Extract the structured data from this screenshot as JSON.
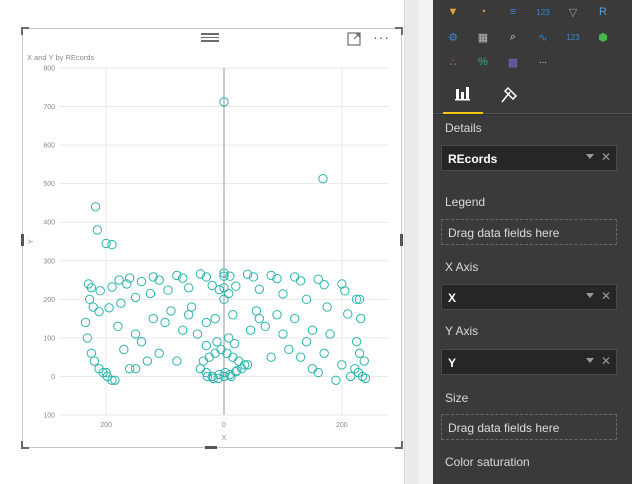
{
  "visual": {
    "title": "X and Y by REcords",
    "more_label": "···"
  },
  "chart_data": {
    "type": "scatter",
    "title": "X and Y by REcords",
    "xlabel": "X",
    "ylabel": "Y",
    "xlim": [
      -280,
      280
    ],
    "ylim": [
      -100,
      800
    ],
    "x_ticks": [
      {
        "value": -200,
        "label": "200"
      },
      {
        "value": 0,
        "label": "0"
      },
      {
        "value": 200,
        "label": "200"
      }
    ],
    "y_ticks": [
      {
        "value": 800,
        "label": "800"
      },
      {
        "value": 700,
        "label": "700"
      },
      {
        "value": 600,
        "label": "600"
      },
      {
        "value": 500,
        "label": "500"
      },
      {
        "value": 400,
        "label": "400"
      },
      {
        "value": 300,
        "label": "300"
      },
      {
        "value": 200,
        "label": "200"
      },
      {
        "value": 100,
        "label": "100"
      },
      {
        "value": 0,
        "label": "0"
      },
      {
        "value": -100,
        "label": "100"
      }
    ],
    "grid": true,
    "marker": "hollow-circle",
    "color": "#2bb5ad",
    "series": [
      {
        "x": [
          0,
          168,
          -218,
          -215,
          -200,
          -190,
          -178,
          -160,
          -120,
          -80,
          -40,
          0,
          40,
          80,
          120,
          160,
          200,
          230,
          -230,
          -225,
          -210,
          -190,
          -165,
          -140,
          -110,
          -70,
          -30,
          10,
          50,
          90,
          130,
          170,
          205,
          225,
          -228,
          -222,
          -212,
          -195,
          -175,
          -150,
          -125,
          -95,
          -60,
          -20,
          20,
          60,
          100,
          140,
          175,
          210,
          232,
          -235,
          -232,
          -225,
          -220,
          -212,
          -205,
          -198,
          -190,
          222,
          228,
          235,
          240,
          238,
          230,
          225,
          -40,
          -30,
          -20,
          -10,
          0,
          10,
          20,
          30,
          40,
          -35,
          -25,
          -15,
          -5,
          5,
          15,
          25,
          35,
          -28,
          -18,
          -8,
          2,
          12,
          22,
          -30,
          -12,
          8,
          18,
          -180,
          -150,
          -120,
          -90,
          -60,
          -30,
          60,
          90,
          120,
          150,
          180,
          -170,
          -140,
          -110,
          -80,
          80,
          110,
          140,
          170,
          -100,
          -70,
          70,
          100,
          -160,
          -55,
          55,
          160,
          -45,
          45,
          -15,
          15,
          0,
          0,
          0,
          8,
          -8,
          200,
          215,
          190,
          -200,
          -185,
          130,
          150,
          -130,
          -150
        ],
        "y": [
          712,
          513,
          440,
          380,
          345,
          342,
          250,
          255,
          258,
          262,
          266,
          268,
          265,
          262,
          258,
          252,
          240,
          200,
          240,
          230,
          222,
          232,
          240,
          246,
          250,
          255,
          258,
          260,
          258,
          254,
          248,
          238,
          222,
          200,
          200,
          180,
          168,
          178,
          190,
          205,
          215,
          224,
          230,
          236,
          234,
          226,
          214,
          200,
          180,
          162,
          150,
          140,
          100,
          60,
          40,
          20,
          10,
          0,
          -10,
          20,
          10,
          0,
          -5,
          40,
          60,
          90,
          20,
          10,
          0,
          -5,
          0,
          5,
          12,
          20,
          30,
          40,
          50,
          60,
          70,
          60,
          50,
          40,
          30,
          0,
          -5,
          5,
          10,
          0,
          15,
          80,
          90,
          100,
          85,
          130,
          110,
          150,
          170,
          160,
          140,
          150,
          160,
          150,
          120,
          110,
          70,
          90,
          60,
          40,
          50,
          70,
          90,
          60,
          140,
          120,
          130,
          110,
          20,
          180,
          170,
          10,
          110,
          120,
          150,
          160,
          200,
          230,
          260,
          215,
          225,
          30,
          0,
          -10,
          10,
          -10,
          50,
          20,
          40,
          20
        ]
      }
    ]
  },
  "viz_pane": {
    "icons": [
      {
        "name": "funnel-icon",
        "glyph": "▼",
        "color": "#e8a33b"
      },
      {
        "name": "gauge-icon",
        "glyph": "◔",
        "color": "#e8a33b"
      },
      {
        "name": "card-icon",
        "glyph": "≡",
        "color": "#3a86d1"
      },
      {
        "name": "multirow-card-icon",
        "glyph": "123",
        "color": "#3a86d1"
      },
      {
        "name": "filter-icon",
        "glyph": "▽",
        "color": "#9a9a9a"
      },
      {
        "name": "r-visual-icon",
        "glyph": "R",
        "color": "#5fa0d8"
      },
      {
        "name": "arcgis-icon",
        "glyph": "⚙",
        "color": "#3a86d1"
      },
      {
        "name": "slicer-icon",
        "glyph": "▦",
        "color": "#bbbbbb"
      },
      {
        "name": "magnifier-icon",
        "glyph": "⌕",
        "color": "#dddddd"
      },
      {
        "name": "line-chart-icon",
        "glyph": "∿",
        "color": "#3a86d1"
      },
      {
        "name": "kpi-icon",
        "glyph": "123",
        "color": "#3a86d1"
      },
      {
        "name": "hexagon-icon",
        "glyph": "⬢",
        "color": "#46b94a"
      },
      {
        "name": "scatter-icon",
        "glyph": "∴",
        "color": "#e05c5c"
      },
      {
        "name": "percent-icon",
        "glyph": "%",
        "color": "#36b37e"
      },
      {
        "name": "matrix-icon",
        "glyph": "▩",
        "color": "#7b63c9"
      },
      {
        "name": "more-visuals-icon",
        "glyph": "···",
        "color": "#ffffff"
      }
    ]
  },
  "pane": {
    "tabs": [
      {
        "name": "fields-tab",
        "icon": "fields-icon"
      },
      {
        "name": "format-tab",
        "icon": "paint-roller-icon"
      }
    ],
    "wells": {
      "details": {
        "label": "Details",
        "value": "REcords"
      },
      "legend": {
        "label": "Legend",
        "placeholder": "Drag data fields here"
      },
      "x_axis": {
        "label": "X Axis",
        "value": "X"
      },
      "y_axis": {
        "label": "Y Axis",
        "value": "Y"
      },
      "size": {
        "label": "Size",
        "placeholder": "Drag data fields here"
      },
      "color_saturation": {
        "label": "Color saturation"
      }
    }
  }
}
